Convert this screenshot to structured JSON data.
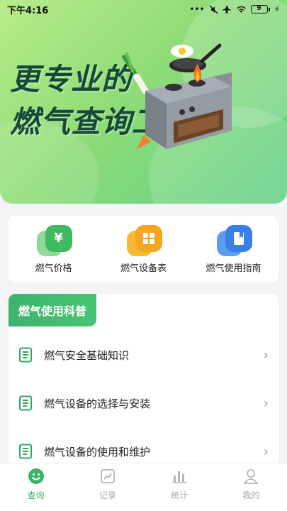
{
  "status": {
    "time": "下午4:16",
    "battery": "9"
  },
  "hero": {
    "line1": "更专业的",
    "line2": "燃气查询工具"
  },
  "quick": [
    {
      "label": "燃气价格",
      "icon": "yen-icon",
      "glyph": "¥"
    },
    {
      "label": "燃气设备表",
      "icon": "grid-icon"
    },
    {
      "label": "燃气使用指南",
      "icon": "book-icon"
    }
  ],
  "science": {
    "title": "燃气使用科普",
    "items": [
      {
        "label": "燃气安全基础知识"
      },
      {
        "label": "燃气设备的选择与安装"
      },
      {
        "label": "燃气设备的使用和维护"
      }
    ]
  },
  "nav": [
    {
      "label": "查询",
      "icon": "smile-icon",
      "active": true
    },
    {
      "label": "记录",
      "icon": "record-icon"
    },
    {
      "label": "统计",
      "icon": "bar-chart-icon"
    },
    {
      "label": "我的",
      "icon": "user-icon"
    }
  ],
  "colors": {
    "accent": "#3db36c",
    "hero_text": "#17493a"
  }
}
